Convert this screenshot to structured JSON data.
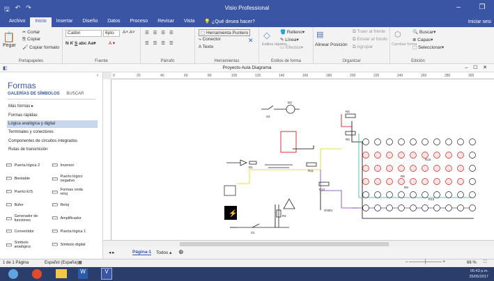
{
  "app": {
    "title": "Visio Professional",
    "doc_title": "Proyecto Aula Diagrama"
  },
  "tabs": [
    "Archivo",
    "Inicio",
    "Insertar",
    "Diseño",
    "Datos",
    "Proceso",
    "Revisar",
    "Vista"
  ],
  "active_tab": "Inicio",
  "tell_me": "¿Qué desea hacer?",
  "signin": "Iniciar sesi",
  "ribbon": {
    "portapapeles": {
      "label": "Portapapeles",
      "paste": "Pegar",
      "cut": "Cortar",
      "copy": "Copiar",
      "format": "Copiar formato"
    },
    "fuente": {
      "label": "Fuente",
      "font": "Calibri",
      "size": "6pto"
    },
    "parrafo": {
      "label": "Párrafo"
    },
    "herramientas": {
      "label": "Herramientas",
      "pointer": "Herramienta Puntero",
      "connector": "Conector",
      "text": "Texto"
    },
    "estilos": {
      "label": "Estilos de forma",
      "styles": "Estilos rápidos",
      "fill": "Relleno",
      "line": "Línea",
      "effects": "Efectos"
    },
    "organizar": {
      "label": "Organizar",
      "align": "Alinear",
      "position": "Posición",
      "front": "Traer al frente",
      "back": "Enviar al fondo",
      "group": "Agrupar"
    },
    "edicion": {
      "label": "Edición",
      "change": "Cambiar forma",
      "find": "Buscar",
      "layers": "Capas",
      "select": "Seleccionar"
    }
  },
  "shapes_panel": {
    "title": "Formas",
    "nav_stencils": "GALERÍAS DE SÍMBOLOS",
    "nav_search": "BUSCAR",
    "items": [
      "Más formas",
      "Formas rápidas",
      "Lógica analógica y digital",
      "Terminales y conectores",
      "Componentes de circuitos integrados",
      "Rutas de transmisión"
    ],
    "selected": "Lógica analógica y digital",
    "shapes": [
      [
        "Puerta lógica 2",
        "Inversor"
      ],
      [
        "Biestable",
        "Puerto lógico negativo"
      ],
      [
        "Puerto E/S",
        "Formas onda reloj"
      ],
      [
        "Búfer",
        "Reloj"
      ],
      [
        "Generador de funciones",
        "Amplificador"
      ],
      [
        "Convertidor",
        "Puerta lógica 1"
      ],
      [
        "Símbolo analógico",
        "Símbolo digital"
      ]
    ]
  },
  "ruler_marks": [
    "0",
    "20",
    "40",
    "60",
    "80",
    "100",
    "120",
    "140",
    "160",
    "180",
    "200",
    "220",
    "240",
    "260",
    "280",
    "300"
  ],
  "page_tabs": {
    "current": "Página-1",
    "all": "Todos"
  },
  "status": {
    "page": "1 de 1 Página",
    "lang": "Español (España)",
    "zoom": "66 %"
  },
  "taskbar": {
    "time": "05:43 p.m.",
    "date": "25/05/2017"
  },
  "circuit_labels": [
    "S2",
    "D0",
    "R4",
    "R5",
    "R11",
    "R12",
    "R10",
    "R8",
    "R9",
    "R13",
    "GND1",
    "R2",
    "S1",
    "D1"
  ]
}
